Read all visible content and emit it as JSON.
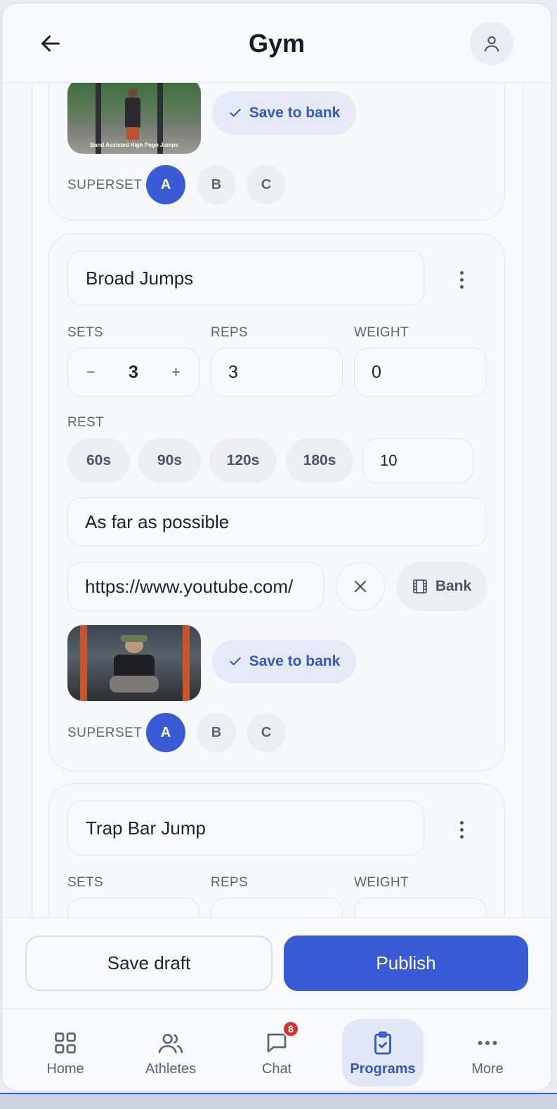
{
  "header": {
    "title": "Gym"
  },
  "exercises": [
    {
      "thumb_caption": "Band Assisted High Pogo Jumps",
      "save_to_bank": "Save to bank",
      "superset": {
        "label": "SUPERSET",
        "options": [
          "A",
          "B",
          "C"
        ],
        "selected": "A"
      }
    },
    {
      "name": "Broad Jumps",
      "sets_label": "SETS",
      "reps_label": "REPS",
      "weight_label": "WEIGHT",
      "sets": {
        "minus": "−",
        "value": "3",
        "plus": "+"
      },
      "reps": "3",
      "weight": "0",
      "rest_label": "REST",
      "rest_options": [
        "60s",
        "90s",
        "120s",
        "180s"
      ],
      "rest_custom": "10",
      "notes": "As far as possible",
      "video_url": "https://www.youtube.com/",
      "bank_label": "Bank",
      "save_to_bank": "Save to bank",
      "superset": {
        "label": "SUPERSET",
        "options": [
          "A",
          "B",
          "C"
        ],
        "selected": "A"
      }
    },
    {
      "name": "Trap Bar Jump",
      "sets_label": "SETS",
      "reps_label": "REPS",
      "weight_label": "WEIGHT"
    }
  ],
  "actions": {
    "save_draft": "Save draft",
    "publish": "Publish"
  },
  "tabs": [
    {
      "label": "Home",
      "icon": "grid-icon"
    },
    {
      "label": "Athletes",
      "icon": "users-icon"
    },
    {
      "label": "Chat",
      "icon": "chat-icon",
      "badge": "8"
    },
    {
      "label": "Programs",
      "icon": "clipboard-check-icon",
      "active": true
    },
    {
      "label": "More",
      "icon": "more-dots-icon"
    }
  ],
  "colors": {
    "accent": "#3a5bd6",
    "badge": "#d7332d"
  }
}
